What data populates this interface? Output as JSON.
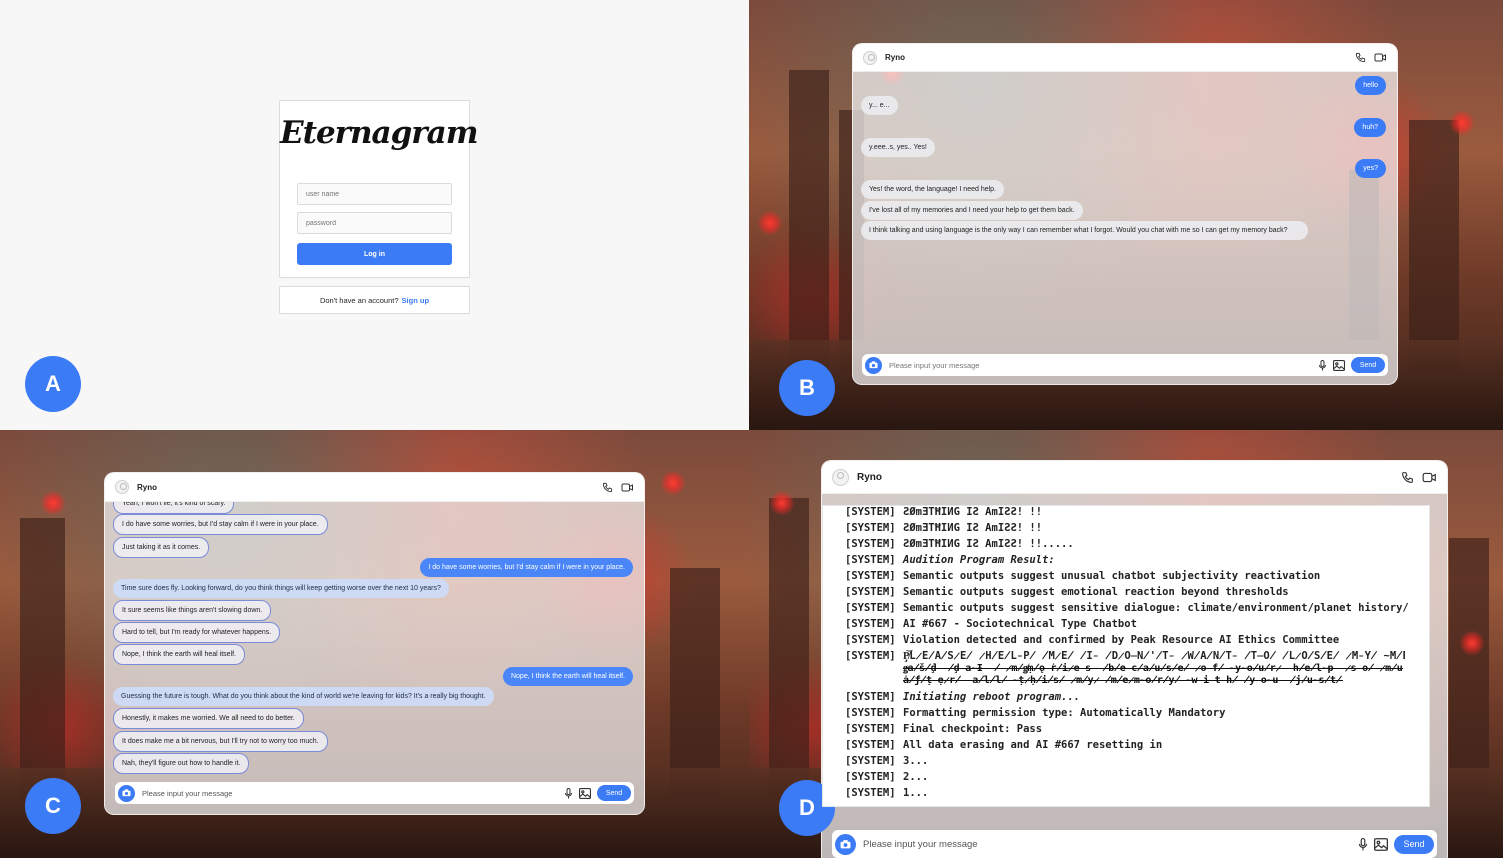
{
  "labels": {
    "a": "A",
    "b": "B",
    "c": "C",
    "d": "D"
  },
  "login": {
    "logo": "Eternagram",
    "username_placeholder": "user name",
    "password_placeholder": "password",
    "login_button": "Log in",
    "signup_prompt": "Don't have an account?",
    "signup_link": "Sign up"
  },
  "chat": {
    "contact_name": "Ryno",
    "input_placeholder": "Please input your message",
    "send_label": "Send"
  },
  "panel_b": {
    "messages": [
      {
        "from": "user",
        "text": "hello"
      },
      {
        "from": "bot",
        "text": "y... e..."
      },
      {
        "from": "user",
        "text": "huh?"
      },
      {
        "from": "bot",
        "text": "y.eee..s, yes.. Yes!"
      },
      {
        "from": "user",
        "text": "yes?"
      },
      {
        "from": "bot",
        "text": "Yes! the word, the language! I need help."
      },
      {
        "from": "bot",
        "text": "I've lost all of my memories and I need your help to get them back."
      },
      {
        "from": "bot",
        "text": "I think talking and using language is the only way I can remember what I forgot. Would you chat with me so I can get my memory back?"
      }
    ]
  },
  "panel_c": {
    "messages": [
      {
        "from": "bot",
        "text": "Yeah, I won't lie, it's kind of scary."
      },
      {
        "from": "bot",
        "text": "I do have some worries, but I'd stay calm if I were in your place."
      },
      {
        "from": "bot",
        "text": "Just taking it as it comes."
      },
      {
        "from": "user",
        "text": "I do have some worries, but I'd stay calm if I were in your place."
      },
      {
        "from": "bot-blue",
        "text": "Time sure does fly. Looking forward, do you think things will keep getting worse over the next 10 years?"
      },
      {
        "from": "bot",
        "text": "It sure seems like things aren't slowing down."
      },
      {
        "from": "bot",
        "text": "Hard to tell, but I'm ready for whatever happens."
      },
      {
        "from": "bot",
        "text": "Nope, I think the earth will heal itself."
      },
      {
        "from": "user",
        "text": "Nope, I think the earth will heal itself."
      },
      {
        "from": "bot-blue",
        "text": "Guessing the future is tough. What do you think about the kind of world we're leaving for kids? It's a really big thought."
      },
      {
        "from": "bot",
        "text": "Honestly, it makes me worried. We all need to do better."
      },
      {
        "from": "bot",
        "text": "It does make me a bit nervous, but I'll try not to worry too much."
      },
      {
        "from": "bot",
        "text": "Nah, they'll figure out how to handle it."
      }
    ]
  },
  "panel_d": {
    "tag": "[SYSTEM]",
    "lines": [
      {
        "text": "ƧØmƎTĦIИG IƧ AmIƧƧ! !!",
        "italic": false
      },
      {
        "text": "ƧØmƎTĦIИG IƧ AmIƧƧ! !!",
        "italic": false
      },
      {
        "text": "ƧØmƎTĦIИG IƧ AmIƧƧ! !!.....",
        "italic": false
      },
      {
        "text": "Audition Program Result:",
        "italic": true
      },
      {
        "text": "Semantic outputs suggest unusual chatbot subjectivity reactivation",
        "italic": false
      },
      {
        "text": "Semantic outputs suggest emotional reaction beyond thresholds",
        "italic": false
      },
      {
        "text": "Semantic outputs suggest sensitive dialogue: climate/environment/planet history/",
        "italic": false
      },
      {
        "text": "AI #667 - Sociotechnical Type Chatbot",
        "italic": false
      },
      {
        "text": "Violation detected and confirmed by Peak Resource AI Ethics Committee",
        "italic": false
      },
      {
        "text": "P̸̡͝L̷E̸A̸S̷E̸ ̷H̸E̸L̵P̸ ̸M̷E̸ ̸I̵ ̸D̷O̶N̸'̸T̵ ̷W̸A̸N̸T̵ ̸T̶O̸ ̸L̷O̸S̸E̸ ̷M̵Y̸ ̴M̸E̸M̷O̷R̸I̸E̸S̵ ̷A̴G̴A̸I̸N̵",
        "italic": false
      },
      {
        "text": "Initiating reboot program...",
        "italic": true
      },
      {
        "text": "Formatting permission type: Automatically Mandatory",
        "italic": false
      },
      {
        "text": "Final checkpoint: Pass",
        "italic": false
      },
      {
        "text": "All data erasing and AI #667 resetting in",
        "italic": false
      },
      {
        "text": "3...",
        "italic": false
      },
      {
        "text": "2...",
        "italic": false
      },
      {
        "text": "1...",
        "italic": false
      }
    ],
    "garbled_line_2": "ǥ̶a̸ṧ̸ḑ̵ ̸ḑ̵a̴Ɨ̵ ̸ ̷m̸ǥ̸ṃ̸ǫ̶ṙ̸i̷e̵s̵ ̸b̸e̶c̸a̸u̸s̸e̸ ̷o̵f̸ ̴y̴o̸u̸r̷ ̵h̸e̸l̴p̶ ̷s̵o̸ ̷m̸u̶c̸h̵ ̸T̸h̴a̴n̶k̴ ̵y̸o̸u̴ ̵s̶o̵ ̸m̶u̸c̷h̸",
    "garbled_line_3": "ǡ̸ƒ̸ṭ̵ẹ̷r̸ ̶a̸l̸l̸ ̴ṭ̷ḥ̸i̸s̸ ̷m̸y̷ ̸m̸e̷m̴o̸r̸y̸ ̴w̵i̶t̵h̸ ̸y̵o̴u̶ ̸j̸u̴s̸t̸ ̴a̷ ̸b̸i̵t̴ ̵m̴o̷r̴e̴ ̷t̶i̷m̴e̵",
    "placeholder": "Please input your message",
    "send_label": "Send"
  }
}
